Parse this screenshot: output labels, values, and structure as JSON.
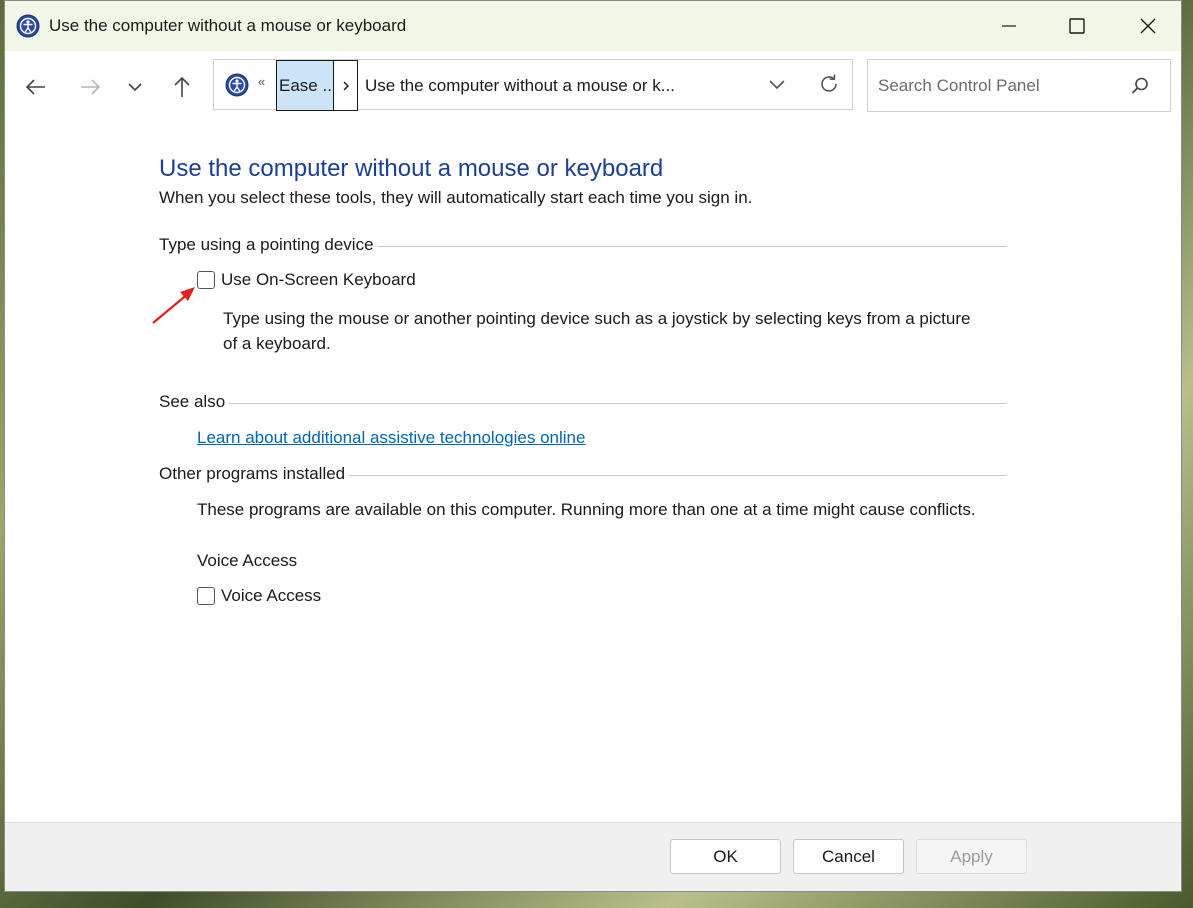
{
  "window": {
    "title": "Use the computer without a mouse or keyboard",
    "controls": [
      "minimize-icon",
      "maximize-icon",
      "close-icon"
    ]
  },
  "address_bar": {
    "overflow_chevron": "«",
    "breadcrumb": "Ease ...",
    "separator": "›",
    "current": "Use the computer without a mouse or k..."
  },
  "search": {
    "placeholder": "Search Control Panel"
  },
  "main": {
    "title": "Use the computer without a mouse or keyboard",
    "subtitle": "When you select these tools, they will automatically start each time you sign in.",
    "pointing_group": {
      "heading": "Type using a pointing device",
      "checkbox_label": "Use On-Screen Keyboard",
      "checked": false,
      "description_line1": "Type using the mouse or another pointing device such as a joystick by selecting keys from a picture",
      "description_line2": "of a keyboard."
    },
    "see_also": {
      "heading": "See also",
      "link": "Learn about additional assistive technologies online"
    },
    "other_programs": {
      "heading": "Other programs installed",
      "description": "These programs are available on this computer. Running more than one at a time might cause conflicts.",
      "program_name": "Voice Access",
      "checkbox_label": "Voice Access",
      "checked": false
    }
  },
  "footer": {
    "ok": "OK",
    "cancel": "Cancel",
    "apply": "Apply"
  },
  "colors": {
    "title_blue": "#1c3e94",
    "link_blue": "#0066b4",
    "annotation_arrow": "#e02020"
  }
}
